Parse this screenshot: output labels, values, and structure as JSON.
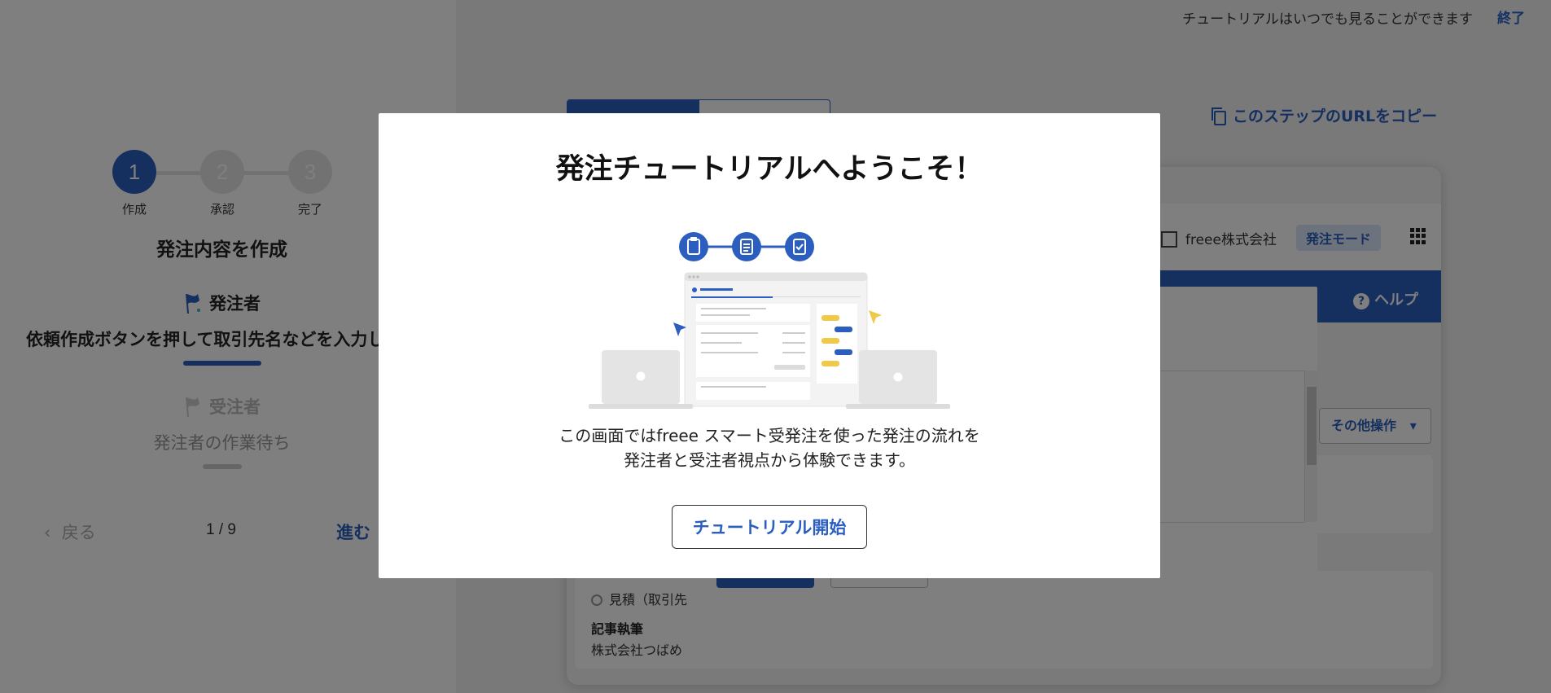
{
  "topbar": {
    "notice": "チュートリアルはいつでも見ることができます",
    "end_label": "終了"
  },
  "stepper": {
    "steps": [
      {
        "number": "1",
        "label": "作成"
      },
      {
        "number": "2",
        "label": "承認"
      },
      {
        "number": "3",
        "label": "完了"
      }
    ]
  },
  "left_panel": {
    "title": "発注内容を作成",
    "roles": [
      {
        "name": "発注者",
        "description": "依頼作成ボタンを押して取引先名などを入力し"
      },
      {
        "name": "受注者",
        "description": "発注者の作業待ち"
      }
    ],
    "nav": {
      "back": "戻る",
      "page": "1 / 9",
      "next": "進む"
    }
  },
  "right_panel": {
    "copy_url": "このステップのURLをコピー",
    "company": "freee株式会社",
    "mode": "発注モード",
    "help": "ヘルプ",
    "other_ops": "その他操作",
    "estimate": "見積（取引先",
    "job_title": "記事執筆",
    "job_client": "株式会社つばめ"
  },
  "modal": {
    "title": "発注チュートリアルへようこそ！",
    "description_line1": "この画面ではfreee スマート受発注を使った発注の流れを",
    "description_line2": "発注者と受注者視点から体験できます。",
    "start_button": "チュートリアル開始"
  },
  "colors": {
    "primary": "#2b5ebf",
    "accent_yellow": "#f0c94a",
    "overlay": "rgba(0,0,0,0.5)"
  }
}
